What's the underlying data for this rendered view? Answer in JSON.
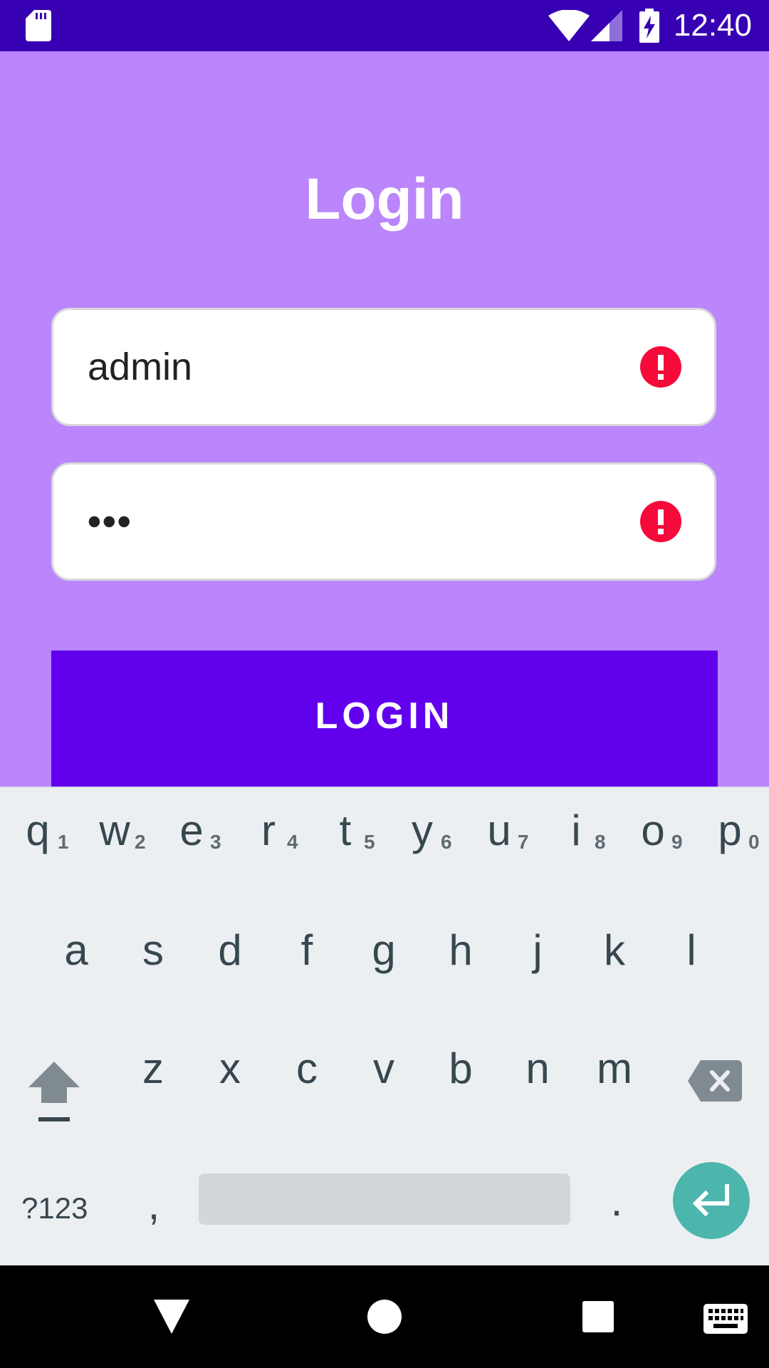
{
  "status_bar": {
    "time": "12:40",
    "icons": [
      "sd-card-icon",
      "wifi-icon",
      "signal-icon",
      "battery-charging-icon"
    ],
    "background": "#3700b3"
  },
  "app": {
    "background": "#bb86fc",
    "title": "Login",
    "username": {
      "value": "admin",
      "error_icon": "error-icon",
      "error_color": "#f50b3a"
    },
    "password": {
      "value": "•••",
      "error_icon": "error-icon",
      "error_color": "#f50b3a"
    },
    "login_button": {
      "label": "LOGIN",
      "color": "#6200ee"
    }
  },
  "keyboard": {
    "row1": [
      {
        "key": "q",
        "hint": "1"
      },
      {
        "key": "w",
        "hint": "2"
      },
      {
        "key": "e",
        "hint": "3"
      },
      {
        "key": "r",
        "hint": "4"
      },
      {
        "key": "t",
        "hint": "5"
      },
      {
        "key": "y",
        "hint": "6"
      },
      {
        "key": "u",
        "hint": "7"
      },
      {
        "key": "i",
        "hint": "8"
      },
      {
        "key": "o",
        "hint": "9"
      },
      {
        "key": "p",
        "hint": "0"
      }
    ],
    "row2": [
      "a",
      "s",
      "d",
      "f",
      "g",
      "h",
      "j",
      "k",
      "l"
    ],
    "row3": [
      "z",
      "x",
      "c",
      "v",
      "b",
      "n",
      "m"
    ],
    "symbols_label": "?123",
    "comma_label": ",",
    "period_label": ".",
    "enter_color": "#4db6ac",
    "icons": [
      "shift-icon",
      "backspace-icon",
      "enter-icon"
    ]
  },
  "nav_bar": {
    "icons": [
      "back-icon",
      "home-icon",
      "recents-icon",
      "keyboard-icon"
    ]
  }
}
